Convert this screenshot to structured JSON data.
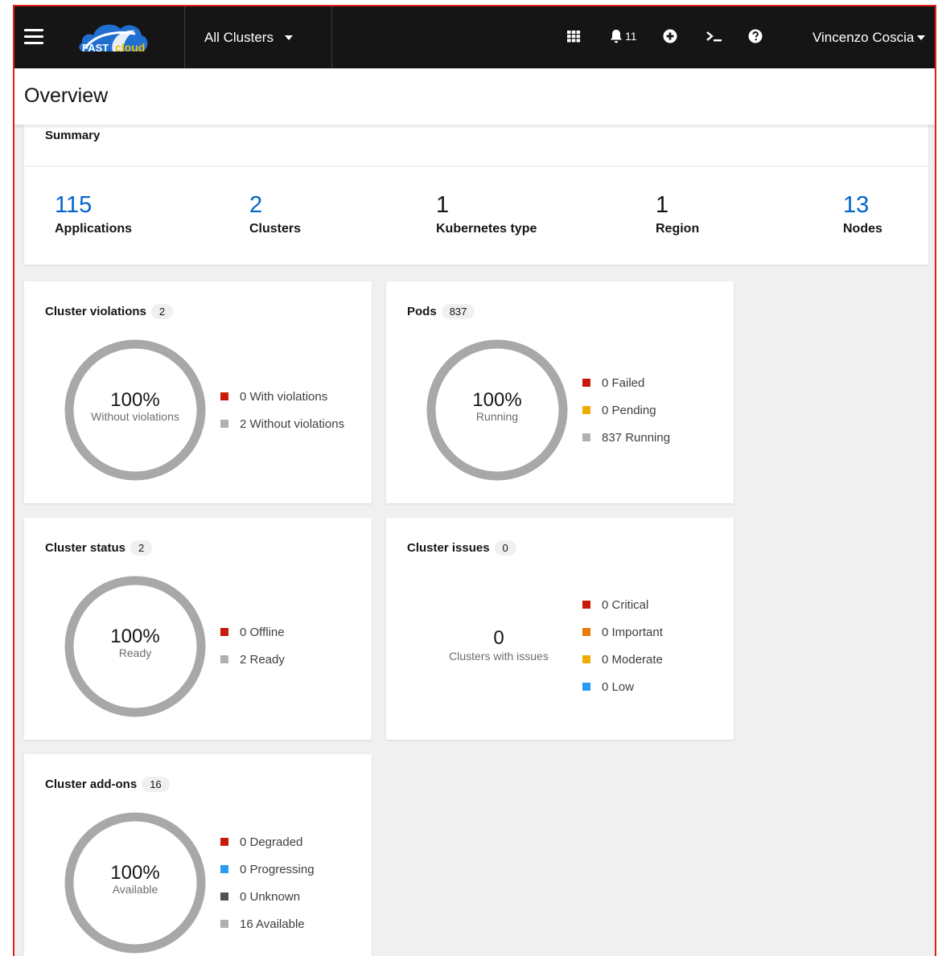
{
  "colors": {
    "masthead_bg": "#151515",
    "accent_link": "#0066cc",
    "danger": "#c9190b",
    "warning": "#f0ab00",
    "important": "#ec7a08",
    "info": "#2b9af3",
    "neutral": "#b0b0b0",
    "unknown": "#4f5255",
    "ring": "#a8a8a8"
  },
  "masthead": {
    "logo_text_a": "FAST",
    "logo_text_b": "cloud",
    "cluster_selector": "All Clusters",
    "notifications_count": "11",
    "user_name": "Vincenzo Coscia",
    "icons": [
      "menu-icon",
      "app-launcher-icon",
      "bell-icon",
      "plus-circle-icon",
      "terminal-icon",
      "help-icon"
    ]
  },
  "page": {
    "title": "Overview"
  },
  "summary": {
    "title": "Summary",
    "stats": [
      {
        "value": "115",
        "label": "Applications"
      },
      {
        "value": "2",
        "label": "Clusters"
      },
      {
        "value": "1",
        "label": "Kubernetes type"
      },
      {
        "value": "1",
        "label": "Region"
      },
      {
        "value": "13",
        "label": "Nodes"
      }
    ]
  },
  "cards": {
    "violations": {
      "title": "Cluster violations",
      "count": "2",
      "donut": {
        "percent": "100%",
        "label": "Without violations",
        "fraction": 1.0
      },
      "legend": [
        "0 With violations",
        "2 Without violations"
      ]
    },
    "pods": {
      "title": "Pods",
      "count": "837",
      "donut": {
        "percent": "100%",
        "label": "Running",
        "fraction": 1.0
      },
      "legend": [
        "0 Failed",
        "0 Pending",
        "837 Running"
      ]
    },
    "status": {
      "title": "Cluster status",
      "count": "2",
      "donut": {
        "percent": "100%",
        "label": "Ready",
        "fraction": 1.0
      },
      "legend": [
        "0 Offline",
        "2 Ready"
      ]
    },
    "issues": {
      "title": "Cluster issues",
      "count": "0",
      "center": {
        "value": "0",
        "label": "Clusters with issues"
      },
      "legend": [
        "0 Critical",
        "0 Important",
        "0 Moderate",
        "0 Low"
      ]
    },
    "addons": {
      "title": "Cluster add-ons",
      "count": "16",
      "donut": {
        "percent": "100%",
        "label": "Available",
        "fraction": 1.0
      },
      "legend": [
        "0 Degraded",
        "0 Progressing",
        "0 Unknown",
        "16 Available"
      ]
    }
  }
}
